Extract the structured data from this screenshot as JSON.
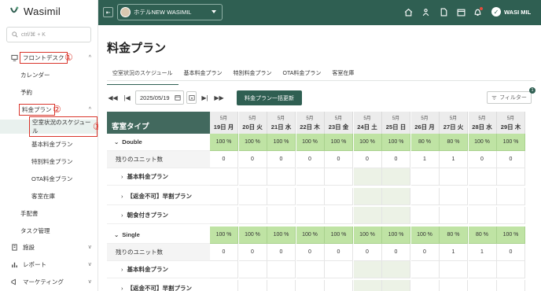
{
  "sidebar": {
    "logo": "Wasimil",
    "search_placeholder": "ctrl/⌘ + K",
    "items": [
      {
        "label": "フロントデスク",
        "annotation": "①"
      },
      {
        "label": "カレンダー"
      },
      {
        "label": "予約"
      },
      {
        "label": "料金プラン",
        "annotation": "②"
      },
      {
        "label": "空室状況のスケジュール",
        "annotation": "③"
      },
      {
        "label": "基本料金プラン"
      },
      {
        "label": "特別料金プラン"
      },
      {
        "label": "OTA料金プラン"
      },
      {
        "label": "客室在庫"
      },
      {
        "label": "手配書"
      },
      {
        "label": "タスク管理"
      },
      {
        "label": "施設"
      },
      {
        "label": "レポート"
      },
      {
        "label": "マーケティング"
      }
    ]
  },
  "topbar": {
    "hotel": "ホテルNEW WASIMIL",
    "user": "WASI MIL"
  },
  "main": {
    "title": "料金プラン",
    "tabs": [
      "空室状況のスケジュール",
      "基本料金プラン",
      "特別料金プラン",
      "OTA料金プラン",
      "客室在庫"
    ],
    "date": "2025/05/19",
    "bulk_update": "料金プラン一括更新",
    "filter": "フィルター",
    "filter_count": "1"
  },
  "table": {
    "room_type_header": "客室タイプ",
    "days": [
      {
        "month": "5月",
        "day": "19日 月"
      },
      {
        "month": "5月",
        "day": "20日 火"
      },
      {
        "month": "5月",
        "day": "21日 水"
      },
      {
        "month": "5月",
        "day": "22日 木"
      },
      {
        "month": "5月",
        "day": "23日 金"
      },
      {
        "month": "5月",
        "day": "24日 土"
      },
      {
        "month": "5月",
        "day": "25日 日"
      },
      {
        "month": "5月",
        "day": "26日 月"
      },
      {
        "month": "5月",
        "day": "27日 火"
      },
      {
        "month": "5月",
        "day": "28日 水"
      },
      {
        "month": "5月",
        "day": "29日 木"
      }
    ],
    "units_label": "残りのユニット数",
    "rooms": [
      {
        "name": "Double",
        "pct": [
          "100 %",
          "100 %",
          "100 %",
          "100 %",
          "100 %",
          "100 %",
          "100 %",
          "80 %",
          "80 %",
          "100 %",
          "100 %"
        ],
        "units": [
          "0",
          "0",
          "0",
          "0",
          "0",
          "0",
          "0",
          "1",
          "1",
          "0",
          "0"
        ],
        "plans": [
          "基本料金プラン",
          "【返金不可】早割プラン",
          "朝食付きプラン"
        ]
      },
      {
        "name": "Single",
        "pct": [
          "100 %",
          "100 %",
          "100 %",
          "100 %",
          "100 %",
          "100 %",
          "100 %",
          "100 %",
          "80 %",
          "80 %",
          "100 %"
        ],
        "units": [
          "0",
          "0",
          "0",
          "0",
          "0",
          "0",
          "0",
          "0",
          "1",
          "1",
          "0"
        ],
        "plans": [
          "基本料金プラン",
          "【返金不可】早割プラン"
        ]
      }
    ]
  }
}
